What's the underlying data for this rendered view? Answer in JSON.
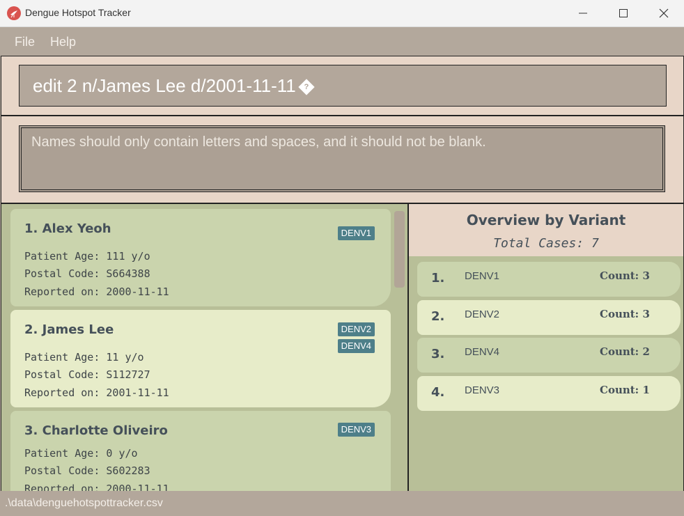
{
  "window": {
    "title": "Dengue Hotspot Tracker",
    "controls": [
      "minimize-icon",
      "maximize-icon",
      "close-icon"
    ]
  },
  "menu": {
    "items": [
      "File",
      "Help"
    ]
  },
  "command_box": {
    "value": "edit 2 n/James Lee d/2001-11-11",
    "trailing_glyph": "?"
  },
  "result_display": {
    "text": "Names should only contain letters and spaces, and it should not be blank."
  },
  "patients": [
    {
      "name": "1. Alex Yeoh",
      "age": "Patient Age: 111 y/o",
      "postal": "Postal Code: S664388",
      "reported": "Reported on: 2000-11-11",
      "variants": [
        "DENV1"
      ]
    },
    {
      "name": "2. James Lee",
      "age": "Patient Age: 11 y/o",
      "postal": "Postal Code: S112727",
      "reported": "Reported on: 2001-11-11",
      "variants": [
        "DENV2",
        "DENV4"
      ]
    },
    {
      "name": "3. Charlotte Oliveiro",
      "age": "Patient Age: 0 y/o",
      "postal": "Postal Code: S602283",
      "reported": "Reported on: 2000-11-11",
      "variants": [
        "DENV3"
      ]
    }
  ],
  "overview": {
    "title": "Overview by Variant",
    "total": "Total Cases: 7",
    "rows": [
      {
        "rank": "1.",
        "variant": "DENV1",
        "count": "Count: 3"
      },
      {
        "rank": "2.",
        "variant": "DENV2",
        "count": "Count: 3"
      },
      {
        "rank": "3.",
        "variant": "DENV4",
        "count": "Count: 2"
      },
      {
        "rank": "4.",
        "variant": "DENV3",
        "count": "Count: 1"
      }
    ]
  },
  "status_bar": {
    "path": ".\\data\\denguehotspottracker.csv"
  },
  "colors": {
    "accent_badge": "#4e7f89",
    "panel_beige": "#e8d6c8",
    "card_green": "#cad4ad",
    "card_light": "#e7ecc9"
  }
}
